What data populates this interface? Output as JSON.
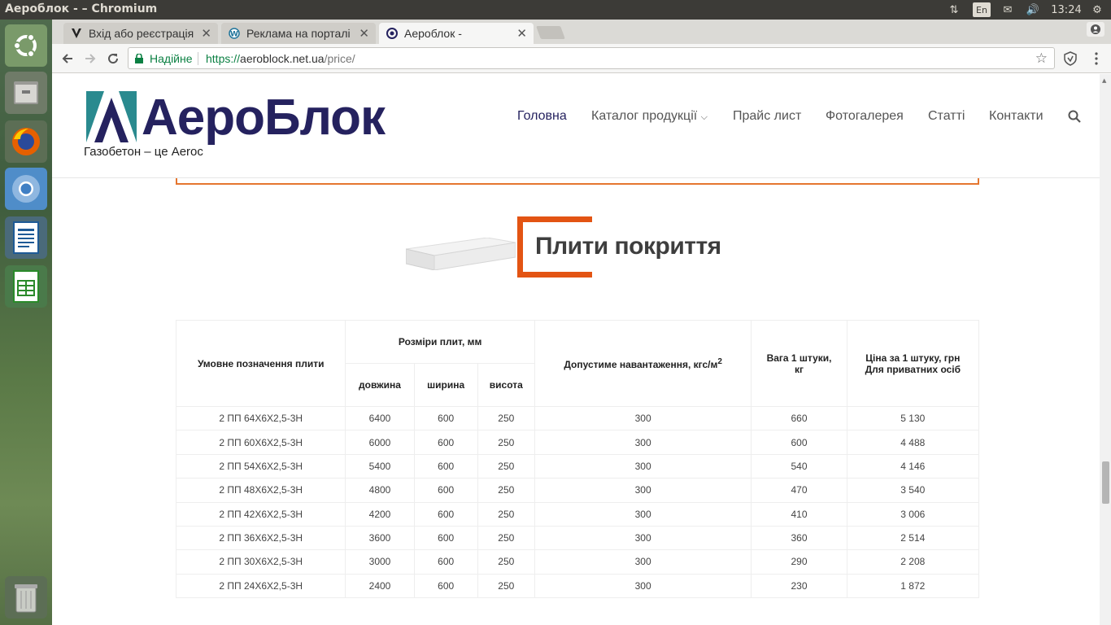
{
  "window": {
    "title": "Аероблок - – Chromium",
    "time": "13:24",
    "lang": "En"
  },
  "tabs": [
    {
      "label": "Вхід або реєстрація",
      "icon": "v-logo-icon"
    },
    {
      "label": "Реклама на порталі",
      "icon": "wordpress-icon"
    },
    {
      "label": "Аероблок -",
      "icon": "aeroblock-icon"
    }
  ],
  "omnibox": {
    "secure_label": "Надійне",
    "url_scheme": "https://",
    "url_host": "aeroblock.net.ua",
    "url_path": "/price/"
  },
  "site": {
    "logo_text": "АероБлок",
    "tagline": "Газобетон – це Aeroc",
    "nav": [
      "Головна",
      "Каталог продукції",
      "Прайс лист",
      "Фотогалерея",
      "Статті",
      "Контакти"
    ],
    "accent": "#e35413",
    "brand_color": "#25225f"
  },
  "section": {
    "title": "Плити покриття"
  },
  "table": {
    "headers": {
      "designation": "Умовне позначення плити",
      "dimensions": "Розміри плит, мм",
      "length": "довжина",
      "width": "ширина",
      "height": "висота",
      "load": "Допустиме навантаження, кгс/м",
      "load_sup": "2",
      "weight": "Вага 1 штуки, кг",
      "price": "Ціна за 1 штуку, грн Для приватних осіб"
    },
    "rows": [
      [
        "2 ПП 64X6X2,5-3H",
        "6400",
        "600",
        "250",
        "300",
        "660",
        "5 130"
      ],
      [
        "2 ПП 60X6X2,5-3H",
        "6000",
        "600",
        "250",
        "300",
        "600",
        "4 488"
      ],
      [
        "2 ПП 54X6X2,5-3H",
        "5400",
        "600",
        "250",
        "300",
        "540",
        "4 146"
      ],
      [
        "2 ПП 48X6X2,5-3H",
        "4800",
        "600",
        "250",
        "300",
        "470",
        "3 540"
      ],
      [
        "2 ПП 42X6X2,5-3H",
        "4200",
        "600",
        "250",
        "300",
        "410",
        "3 006"
      ],
      [
        "2 ПП 36X6X2,5-3H",
        "3600",
        "600",
        "250",
        "300",
        "360",
        "2 514"
      ],
      [
        "2 ПП 30X6X2,5-3H",
        "3000",
        "600",
        "250",
        "300",
        "290",
        "2 208"
      ],
      [
        "2 ПП 24X6X2,5-3H",
        "2400",
        "600",
        "250",
        "300",
        "230",
        "1 872"
      ]
    ]
  }
}
